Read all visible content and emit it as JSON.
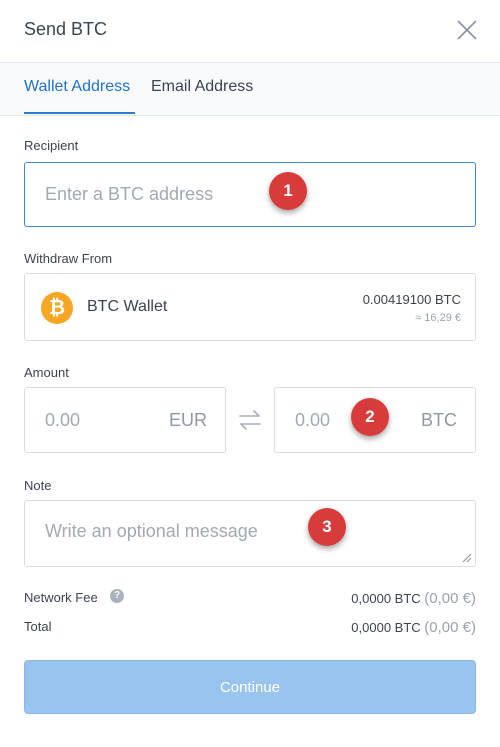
{
  "header": {
    "title": "Send BTC"
  },
  "tabs": [
    {
      "label": "Wallet Address",
      "active": true
    },
    {
      "label": "Email Address",
      "active": false
    }
  ],
  "recipient": {
    "label": "Recipient",
    "placeholder": "Enter a BTC address",
    "value": ""
  },
  "withdraw": {
    "label": "Withdraw From",
    "wallet_name": "BTC Wallet",
    "balance_btc": "0.00419100 BTC",
    "balance_eur": "≈ 16,29 €",
    "icon": "bitcoin-logo-icon",
    "icon_color": "#f7a723"
  },
  "amount": {
    "label": "Amount",
    "eur_value": "0.00",
    "eur_currency": "EUR",
    "btc_value": "0.00",
    "btc_currency": "BTC"
  },
  "note": {
    "label": "Note",
    "placeholder": "Write an optional message",
    "value": ""
  },
  "fees": {
    "network_fee_label": "Network Fee",
    "network_fee_btc": "0,0000 BTC",
    "network_fee_eur": "(0,00 €)",
    "total_label": "Total",
    "total_btc": "0,0000 BTC",
    "total_eur": "(0,00 €)"
  },
  "continue_label": "Continue",
  "annotations": [
    "1",
    "2",
    "3"
  ],
  "colors": {
    "accent": "#1f72c8",
    "button_disabled": "#9ac4f0",
    "badge": "#d93a3a"
  }
}
